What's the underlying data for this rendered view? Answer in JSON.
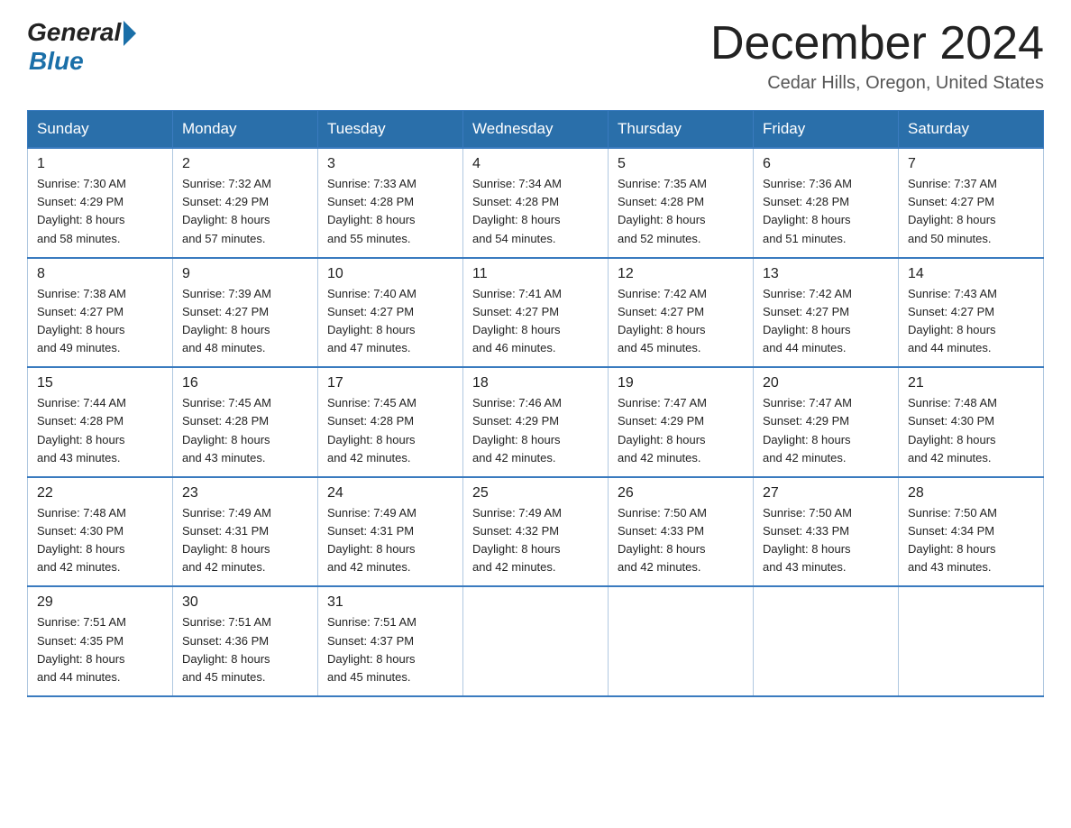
{
  "header": {
    "logo_general": "General",
    "logo_blue": "Blue",
    "month_title": "December 2024",
    "location": "Cedar Hills, Oregon, United States"
  },
  "days_of_week": [
    "Sunday",
    "Monday",
    "Tuesday",
    "Wednesday",
    "Thursday",
    "Friday",
    "Saturday"
  ],
  "weeks": [
    [
      {
        "day": "1",
        "sunrise": "7:30 AM",
        "sunset": "4:29 PM",
        "daylight": "8 hours and 58 minutes."
      },
      {
        "day": "2",
        "sunrise": "7:32 AM",
        "sunset": "4:29 PM",
        "daylight": "8 hours and 57 minutes."
      },
      {
        "day": "3",
        "sunrise": "7:33 AM",
        "sunset": "4:28 PM",
        "daylight": "8 hours and 55 minutes."
      },
      {
        "day": "4",
        "sunrise": "7:34 AM",
        "sunset": "4:28 PM",
        "daylight": "8 hours and 54 minutes."
      },
      {
        "day": "5",
        "sunrise": "7:35 AM",
        "sunset": "4:28 PM",
        "daylight": "8 hours and 52 minutes."
      },
      {
        "day": "6",
        "sunrise": "7:36 AM",
        "sunset": "4:28 PM",
        "daylight": "8 hours and 51 minutes."
      },
      {
        "day": "7",
        "sunrise": "7:37 AM",
        "sunset": "4:27 PM",
        "daylight": "8 hours and 50 minutes."
      }
    ],
    [
      {
        "day": "8",
        "sunrise": "7:38 AM",
        "sunset": "4:27 PM",
        "daylight": "8 hours and 49 minutes."
      },
      {
        "day": "9",
        "sunrise": "7:39 AM",
        "sunset": "4:27 PM",
        "daylight": "8 hours and 48 minutes."
      },
      {
        "day": "10",
        "sunrise": "7:40 AM",
        "sunset": "4:27 PM",
        "daylight": "8 hours and 47 minutes."
      },
      {
        "day": "11",
        "sunrise": "7:41 AM",
        "sunset": "4:27 PM",
        "daylight": "8 hours and 46 minutes."
      },
      {
        "day": "12",
        "sunrise": "7:42 AM",
        "sunset": "4:27 PM",
        "daylight": "8 hours and 45 minutes."
      },
      {
        "day": "13",
        "sunrise": "7:42 AM",
        "sunset": "4:27 PM",
        "daylight": "8 hours and 44 minutes."
      },
      {
        "day": "14",
        "sunrise": "7:43 AM",
        "sunset": "4:27 PM",
        "daylight": "8 hours and 44 minutes."
      }
    ],
    [
      {
        "day": "15",
        "sunrise": "7:44 AM",
        "sunset": "4:28 PM",
        "daylight": "8 hours and 43 minutes."
      },
      {
        "day": "16",
        "sunrise": "7:45 AM",
        "sunset": "4:28 PM",
        "daylight": "8 hours and 43 minutes."
      },
      {
        "day": "17",
        "sunrise": "7:45 AM",
        "sunset": "4:28 PM",
        "daylight": "8 hours and 42 minutes."
      },
      {
        "day": "18",
        "sunrise": "7:46 AM",
        "sunset": "4:29 PM",
        "daylight": "8 hours and 42 minutes."
      },
      {
        "day": "19",
        "sunrise": "7:47 AM",
        "sunset": "4:29 PM",
        "daylight": "8 hours and 42 minutes."
      },
      {
        "day": "20",
        "sunrise": "7:47 AM",
        "sunset": "4:29 PM",
        "daylight": "8 hours and 42 minutes."
      },
      {
        "day": "21",
        "sunrise": "7:48 AM",
        "sunset": "4:30 PM",
        "daylight": "8 hours and 42 minutes."
      }
    ],
    [
      {
        "day": "22",
        "sunrise": "7:48 AM",
        "sunset": "4:30 PM",
        "daylight": "8 hours and 42 minutes."
      },
      {
        "day": "23",
        "sunrise": "7:49 AM",
        "sunset": "4:31 PM",
        "daylight": "8 hours and 42 minutes."
      },
      {
        "day": "24",
        "sunrise": "7:49 AM",
        "sunset": "4:31 PM",
        "daylight": "8 hours and 42 minutes."
      },
      {
        "day": "25",
        "sunrise": "7:49 AM",
        "sunset": "4:32 PM",
        "daylight": "8 hours and 42 minutes."
      },
      {
        "day": "26",
        "sunrise": "7:50 AM",
        "sunset": "4:33 PM",
        "daylight": "8 hours and 42 minutes."
      },
      {
        "day": "27",
        "sunrise": "7:50 AM",
        "sunset": "4:33 PM",
        "daylight": "8 hours and 43 minutes."
      },
      {
        "day": "28",
        "sunrise": "7:50 AM",
        "sunset": "4:34 PM",
        "daylight": "8 hours and 43 minutes."
      }
    ],
    [
      {
        "day": "29",
        "sunrise": "7:51 AM",
        "sunset": "4:35 PM",
        "daylight": "8 hours and 44 minutes."
      },
      {
        "day": "30",
        "sunrise": "7:51 AM",
        "sunset": "4:36 PM",
        "daylight": "8 hours and 45 minutes."
      },
      {
        "day": "31",
        "sunrise": "7:51 AM",
        "sunset": "4:37 PM",
        "daylight": "8 hours and 45 minutes."
      },
      null,
      null,
      null,
      null
    ]
  ]
}
